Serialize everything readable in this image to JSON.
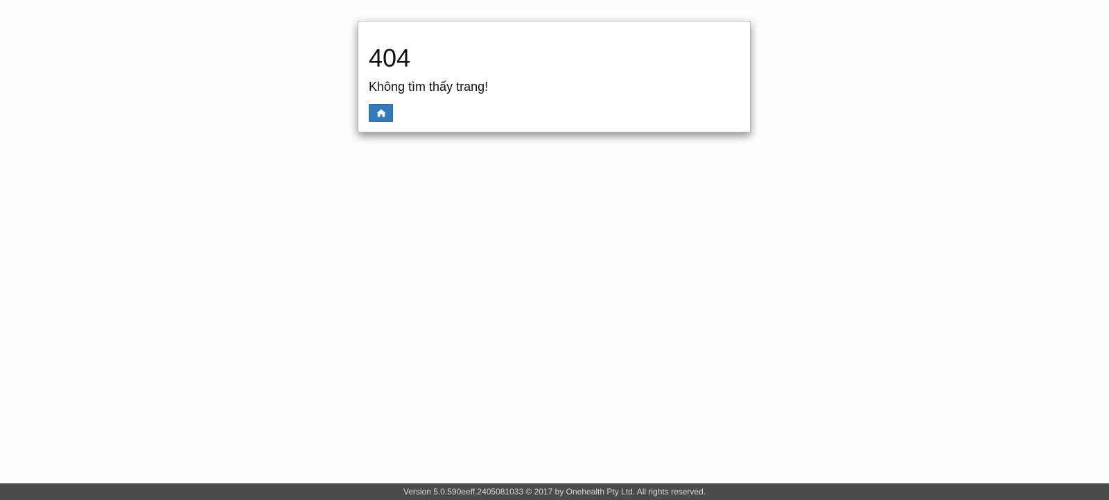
{
  "error": {
    "code": "404",
    "message": "Không tìm thấy trang!",
    "home_icon": "home-icon"
  },
  "colors": {
    "button_bg": "#337ab7",
    "footer_bg": "#4b4b4b"
  },
  "footer": {
    "text": "Version 5.0.590eeff.2405081033 © 2017 by Onehealth Pty Ltd. All rights reserved."
  }
}
